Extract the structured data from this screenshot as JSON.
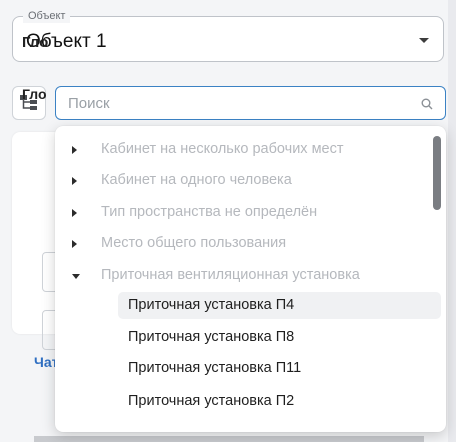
{
  "object_select": {
    "legend": "Объект",
    "value": "Объект 1"
  },
  "search": {
    "placeholder": "Поиск",
    "value": ""
  },
  "background": {
    "title_1": "Гло",
    "title_2": "Гло",
    "link": "Чат"
  },
  "dropdown": {
    "categories": [
      {
        "label": "Кабинет на несколько рабочих мест",
        "expanded": false
      },
      {
        "label": "Кабинет на одного человека",
        "expanded": false
      },
      {
        "label": "Тип пространства не определён",
        "expanded": false
      },
      {
        "label": "Место общего пользования",
        "expanded": false
      },
      {
        "label": "Приточная вентиляционная установка",
        "expanded": true
      }
    ],
    "children": [
      {
        "label": "Приточная установка П4",
        "hovered": true
      },
      {
        "label": "Приточная установка П8",
        "hovered": false
      },
      {
        "label": "Приточная установка П11",
        "hovered": false
      },
      {
        "label": "Приточная установка П2",
        "hovered": false
      }
    ]
  },
  "colors": {
    "accent_border": "#3b82c4",
    "muted_text": "#b5b8bd",
    "link": "#2f6fc2"
  }
}
